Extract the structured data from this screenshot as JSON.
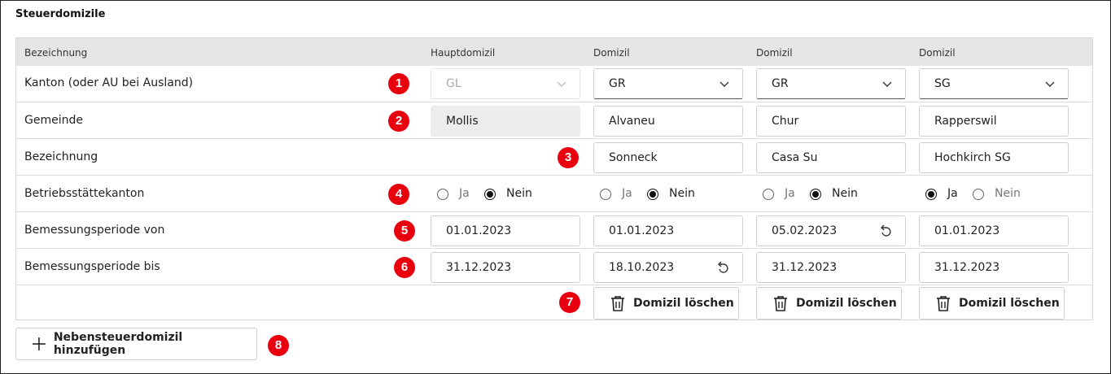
{
  "section_title": "Steuerdomizile",
  "headers": [
    "Bezeichnung",
    "Hauptdomizil",
    "Domizil",
    "Domizil",
    "Domizil"
  ],
  "rows": {
    "kanton": {
      "label": "Kanton (oder AU bei Ausland)",
      "badge": "1",
      "values": [
        "GL",
        "GR",
        "GR",
        "SG"
      ]
    },
    "gemeinde": {
      "label": "Gemeinde",
      "badge": "2",
      "values": [
        "Mollis",
        "Alvaneu",
        "Chur",
        "Rapperswil"
      ]
    },
    "bezeichnung": {
      "label": "Bezeichnung",
      "badge": "3",
      "values": [
        "Sonneck",
        "Casa Su",
        "Hochkirch SG"
      ]
    },
    "betriebsstaette": {
      "label": "Betriebsstättekanton",
      "badge": "4",
      "option_yes": "Ja",
      "option_no": "Nein",
      "selected": [
        "Nein",
        "Nein",
        "Nein",
        "Ja"
      ]
    },
    "periode_von": {
      "label": "Bemessungsperiode von",
      "badge": "5",
      "values": [
        "01.01.2023",
        "01.01.2023",
        "05.02.2023",
        "01.01.2023"
      ]
    },
    "periode_bis": {
      "label": "Bemessungsperiode bis",
      "badge": "6",
      "values": [
        "31.12.2023",
        "18.10.2023",
        "31.12.2023",
        "31.12.2023"
      ]
    },
    "actions": {
      "badge": "7",
      "delete_label": "Domizil löschen"
    }
  },
  "add_button": {
    "label": "Nebensteuerdomizil hinzufügen",
    "badge": "8"
  },
  "colors": {
    "badge": "#e8000f",
    "header_bg": "#e5e5e5",
    "readonly_bg": "#ececec"
  },
  "icons": {
    "dropdown": "chevron-down-icon",
    "reset": "undo-icon",
    "delete": "trash-icon",
    "add": "plus-icon"
  }
}
